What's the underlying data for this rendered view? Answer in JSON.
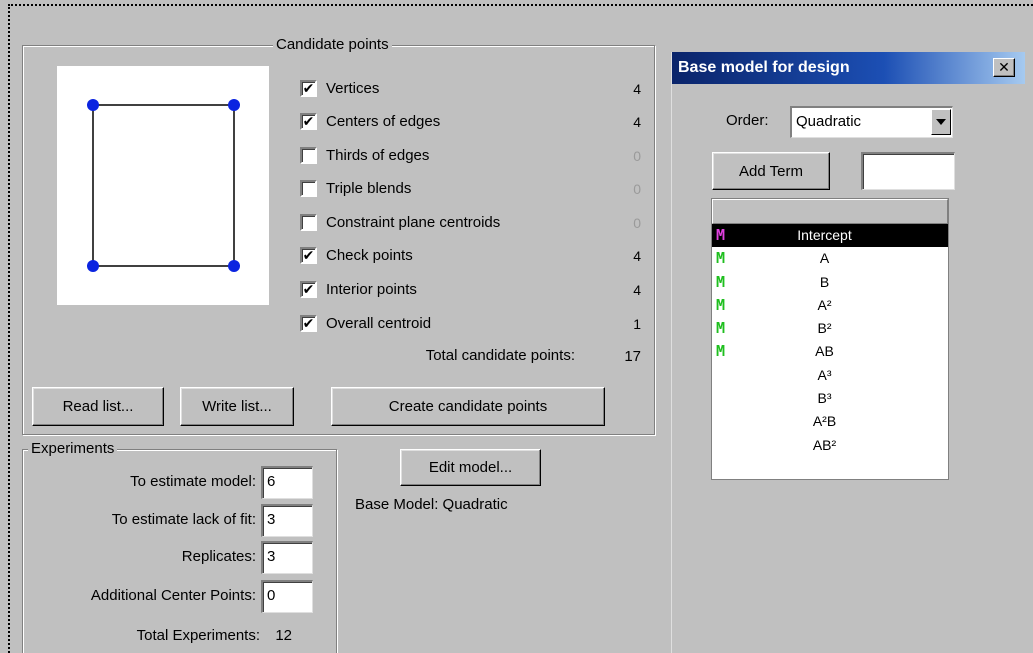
{
  "candidate_points": {
    "title": "Candidate points",
    "options": [
      {
        "label": "Vertices",
        "checked": true,
        "count": "4",
        "dim": false
      },
      {
        "label": "Centers of edges",
        "checked": true,
        "count": "4",
        "dim": false
      },
      {
        "label": "Thirds of edges",
        "checked": false,
        "count": "0",
        "dim": true
      },
      {
        "label": "Triple blends",
        "checked": false,
        "count": "0",
        "dim": true
      },
      {
        "label": "Constraint plane centroids",
        "checked": false,
        "count": "0",
        "dim": true
      },
      {
        "label": "Check points",
        "checked": true,
        "count": "4",
        "dim": false
      },
      {
        "label": "Interior points",
        "checked": true,
        "count": "4",
        "dim": false
      },
      {
        "label": "Overall centroid",
        "checked": true,
        "count": "1",
        "dim": false
      }
    ],
    "total_label": "Total candidate points:",
    "total_value": "17",
    "read_list_label": "Read list...",
    "write_list_label": "Write list...",
    "create_label": "Create candidate points",
    "check_glyph": "✔"
  },
  "experiments": {
    "title": "Experiments",
    "fields": [
      {
        "label": "To estimate model:",
        "value": "6"
      },
      {
        "label": "To estimate lack of fit:",
        "value": "3"
      },
      {
        "label": "Replicates:",
        "value": "3"
      },
      {
        "label": "Additional Center Points:",
        "value": "0"
      }
    ],
    "total_label": "Total Experiments:",
    "total_value": "12"
  },
  "model": {
    "edit_label": "Edit model...",
    "base_model_text": "Base Model: Quadratic"
  },
  "dialog": {
    "title": "Base model for design",
    "close_glyph": "✕",
    "order_label": "Order:",
    "order_value": "Quadratic",
    "add_term_label": "Add Term",
    "add_term_input": "",
    "term_icon_glyph": "M",
    "terms": [
      {
        "name": "Intercept",
        "icon": "magenta",
        "selected": true
      },
      {
        "name": "A",
        "icon": "green",
        "selected": false
      },
      {
        "name": "B",
        "icon": "green",
        "selected": false
      },
      {
        "name": "A²",
        "icon": "green",
        "selected": false
      },
      {
        "name": "B²",
        "icon": "green",
        "selected": false
      },
      {
        "name": "AB",
        "icon": "green",
        "selected": false
      },
      {
        "name": "A³",
        "icon": "none",
        "selected": false
      },
      {
        "name": "B³",
        "icon": "none",
        "selected": false
      },
      {
        "name": "A²B",
        "icon": "none",
        "selected": false
      },
      {
        "name": "AB²",
        "icon": "none",
        "selected": false
      }
    ]
  },
  "colors": {
    "vertex_dot": "#0b24e0",
    "icon_included": "#1fbf1f",
    "icon_fixed": "#e040e0",
    "titlebar": "#0a246a"
  }
}
